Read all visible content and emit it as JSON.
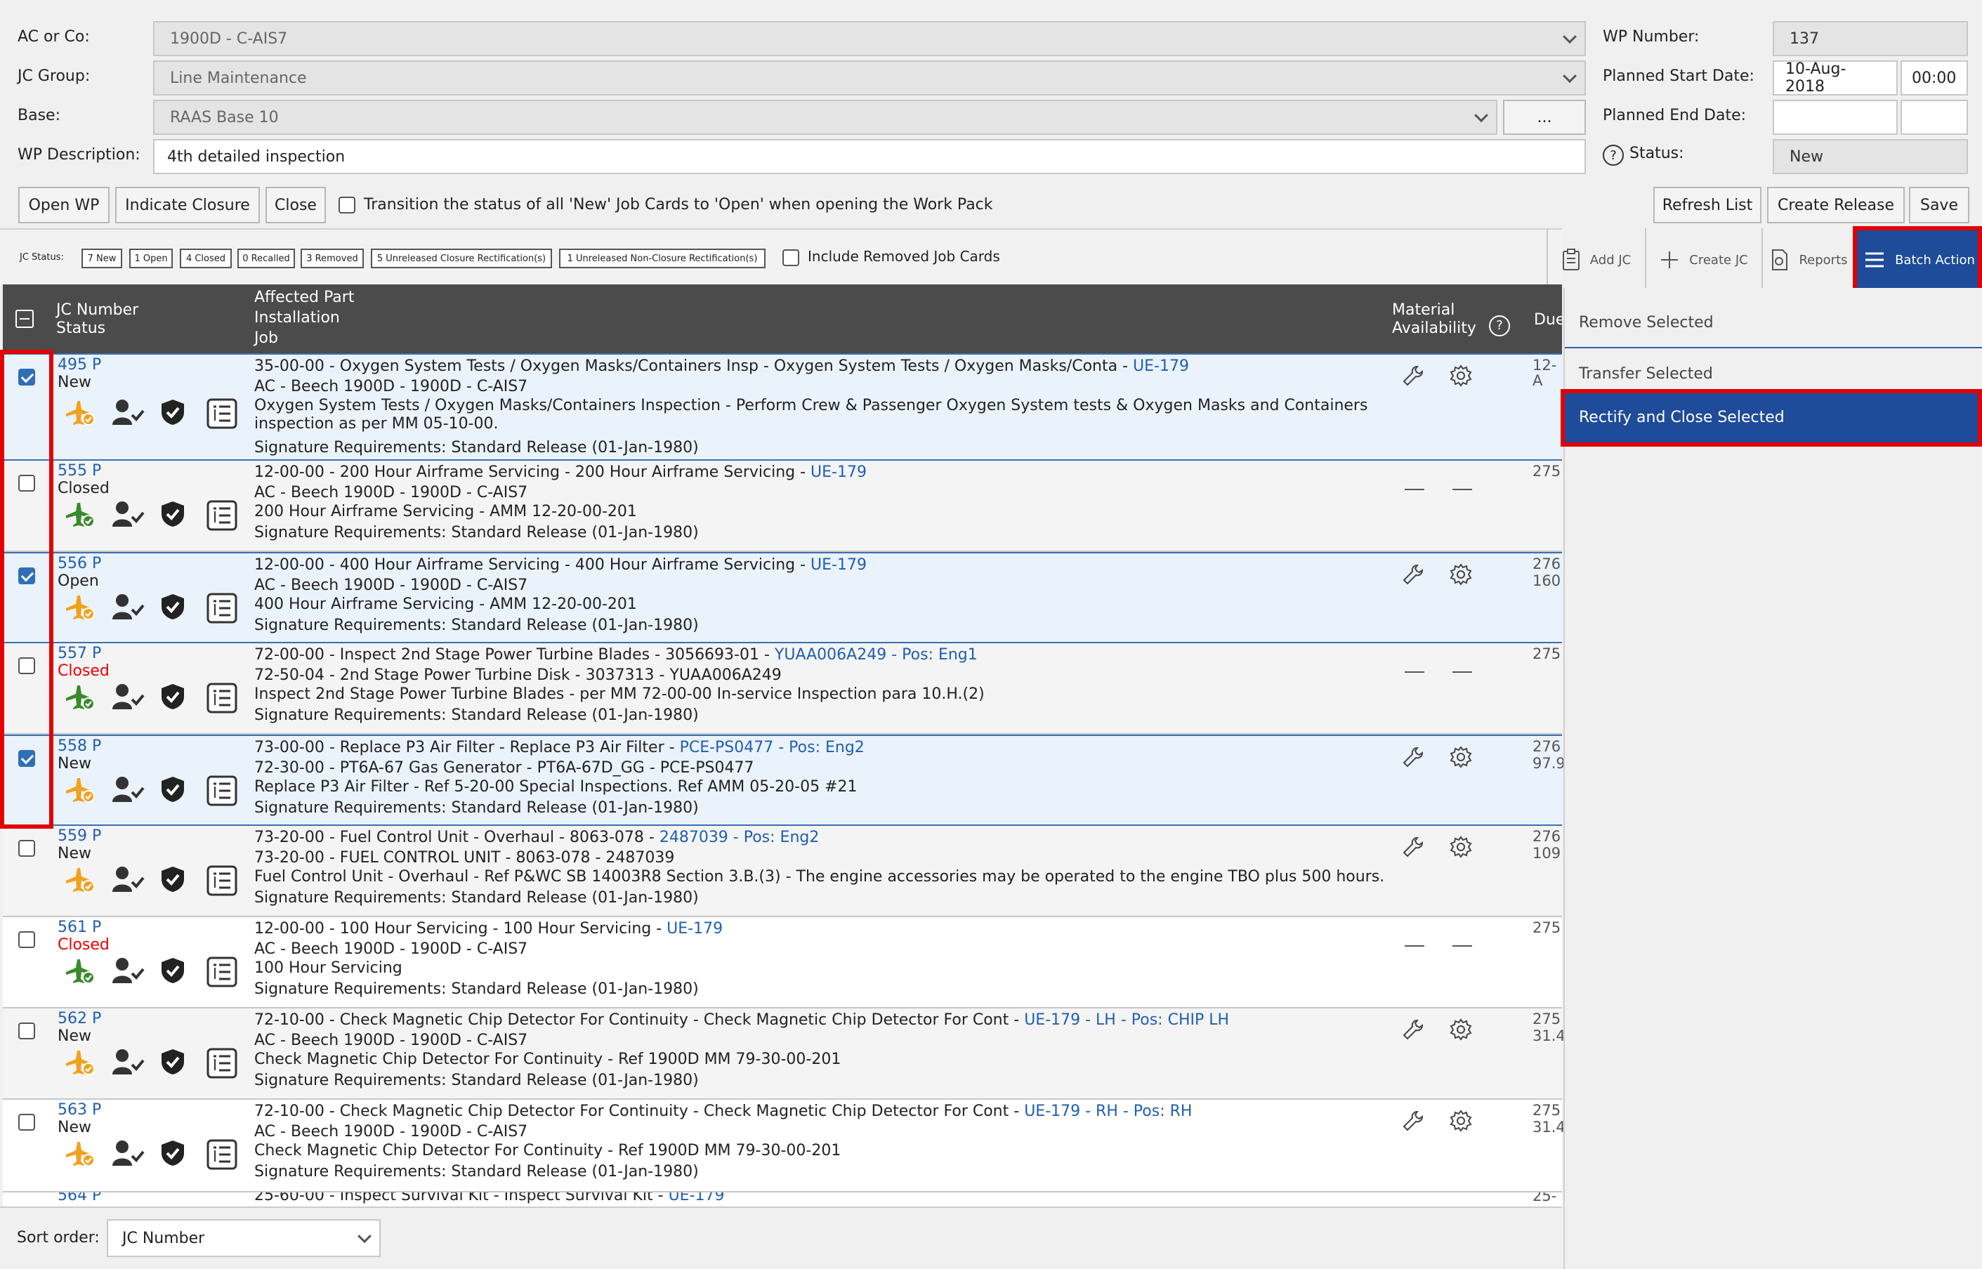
{
  "form": {
    "ac_label": "AC or Co:",
    "ac_value": "1900D - C-AIS7",
    "jc_group_label": "JC Group:",
    "jc_group_value": "Line Maintenance",
    "base_label": "Base:",
    "base_value": "RAAS Base 10",
    "base_btn": "...",
    "desc_label": "WP Description:",
    "desc_value": "4th detailed inspection",
    "wp_number_label": "WP Number:",
    "wp_number_value": "137",
    "start_label": "Planned Start Date:",
    "start_date": "10-Aug-2018",
    "start_time": "00:00",
    "end_label": "Planned End Date:",
    "end_date": "",
    "end_time": "",
    "status_label": "Status:",
    "status_value": "New"
  },
  "actions": {
    "open_wp": "Open WP",
    "indicate_closure": "Indicate Closure",
    "close": "Close",
    "transition_label": "Transition the status of all 'New' Job Cards to 'Open' when opening the Work Pack",
    "refresh": "Refresh List",
    "create_release": "Create Release",
    "save": "Save"
  },
  "status_bar": {
    "label": "JC Status:",
    "chips": [
      "7 New",
      "1 Open",
      "4 Closed",
      "0 Recalled",
      "3 Removed",
      "5 Unreleased Closure Rectification(s)",
      "1 Unreleased Non-Closure Rectification(s)"
    ],
    "include_removed": "Include Removed Job Cards"
  },
  "toolbar": {
    "add_jc": "Add JC",
    "create_jc": "Create JC",
    "reports": "Reports",
    "batch_action": "Batch Action"
  },
  "table": {
    "h_jc1": "JC Number",
    "h_jc2": "Status",
    "h_job1": "Affected Part",
    "h_job2": "Installation",
    "h_job3": "Job",
    "h_mat1": "Material",
    "h_mat2": "Availability",
    "h_due": "Due"
  },
  "rows": [
    {
      "num": "495 P",
      "status": "New",
      "l1": "35-00-00 - Oxygen System Tests / Oxygen Masks/Containers Insp - Oxygen System Tests / Oxygen Masks/Conta - ",
      "l1link": "UE-179",
      "l2": "AC - Beech 1900D - 1900D - C-AIS7",
      "l3": "Oxygen System Tests / Oxygen Masks/Containers Inspection - Perform Crew & Passenger Oxygen System tests & Oxygen Masks and Containers inspection as per MM 05-10-00.",
      "sig": "Signature Requirements: Standard Release (01-Jan-1980)",
      "due1": "12-A",
      "due2": ""
    },
    {
      "num": "555 P",
      "status": "Closed",
      "l1": "12-00-00 - 200 Hour Airframe Servicing - 200 Hour Airframe Servicing - ",
      "l1link": "UE-179",
      "l2": "AC - Beech 1900D - 1900D - C-AIS7",
      "l3": "200 Hour Airframe Servicing - AMM 12-20-00-201",
      "sig": "Signature Requirements: Standard Release (01-Jan-1980)",
      "due1": "275",
      "due2": ""
    },
    {
      "num": "556 P",
      "status": "Open",
      "l1": "12-00-00 - 400 Hour Airframe Servicing - 400 Hour Airframe Servicing - ",
      "l1link": "UE-179",
      "l2": "AC - Beech 1900D - 1900D - C-AIS7",
      "l3": "400 Hour Airframe Servicing - AMM 12-20-00-201",
      "sig": "Signature Requirements: Standard Release (01-Jan-1980)",
      "due1": "276",
      "due2": "160"
    },
    {
      "num": "557 P",
      "status": "Closed",
      "l1": "72-00-00 - Inspect 2nd Stage Power Turbine Blades - 3056693-01 - ",
      "l1link": "YUAA006A249 - Pos: Eng1",
      "l2": "72-50-04 - 2nd Stage Power Turbine Disk - 3037313 - YUAA006A249",
      "l3": "Inspect 2nd Stage Power Turbine Blades - per MM 72-00-00 In-service Inspection para 10.H.(2)",
      "sig": "Signature Requirements: Standard Release (01-Jan-1980)",
      "due1": "275",
      "due2": ""
    },
    {
      "num": "558 P",
      "status": "New",
      "l1": "73-00-00 - Replace P3 Air Filter - Replace P3 Air Filter - ",
      "l1link": "PCE-PS0477 - Pos: Eng2",
      "l2": "72-30-00 - PT6A-67 Gas Generator - PT6A-67D_GG - PCE-PS0477",
      "l3": "Replace P3 Air Filter - Ref 5-20-00 Special Inspections. Ref AMM 05-20-05 #21",
      "sig": "Signature Requirements: Standard Release (01-Jan-1980)",
      "due1": "276",
      "due2": "97.9"
    },
    {
      "num": "559 P",
      "status": "New",
      "l1": "73-20-00 - Fuel Control Unit - Overhaul - 8063-078 - ",
      "l1link": "2487039 - Pos: Eng2",
      "l2": "73-20-00 - FUEL CONTROL UNIT - 8063-078 - 2487039",
      "l3": "Fuel Control Unit - Overhaul - Ref P&WC SB 14003R8 Section 3.B.(3) - The engine accessories may be operated to the engine TBO plus 500 hours.",
      "sig": "Signature Requirements: Standard Release (01-Jan-1980)",
      "due1": "276",
      "due2": "109"
    },
    {
      "num": "561 P",
      "status": "Closed",
      "l1": "12-00-00 - 100 Hour Servicing - 100 Hour Servicing - ",
      "l1link": "UE-179",
      "l2": "AC - Beech 1900D - 1900D - C-AIS7",
      "l3": "100 Hour Servicing",
      "sig": "Signature Requirements: Standard Release (01-Jan-1980)",
      "due1": "275",
      "due2": ""
    },
    {
      "num": "562 P",
      "status": "New",
      "l1": "72-10-00 - Check Magnetic Chip Detector For Continuity - Check Magnetic Chip Detector For Cont - ",
      "l1link": "UE-179 - LH - Pos: CHIP LH",
      "l2": "AC - Beech 1900D - 1900D - C-AIS7",
      "l3": "Check Magnetic Chip Detector For Continuity - Ref 1900D MM 79-30-00-201",
      "sig": "Signature Requirements: Standard Release (01-Jan-1980)",
      "due1": "275",
      "due2": "31.4"
    },
    {
      "num": "563 P",
      "status": "New",
      "l1": "72-10-00 - Check Magnetic Chip Detector For Continuity - Check Magnetic Chip Detector For Cont - ",
      "l1link": "UE-179 - RH - Pos: RH",
      "l2": "AC - Beech 1900D - 1900D - C-AIS7",
      "l3": "Check Magnetic Chip Detector For Continuity - Ref 1900D MM 79-30-00-201",
      "sig": "Signature Requirements: Standard Release (01-Jan-1980)",
      "due1": "275",
      "due2": "31.4"
    }
  ],
  "partial_row": {
    "num": "564 P",
    "l1": "25-60-00 - Inspect Survival Kit - Inspect Survival Kit - ",
    "l1link": "UE-179",
    "due1": "25-"
  },
  "batch_menu": {
    "remove": "Remove Selected",
    "transfer": "Transfer Selected",
    "rectify": "Rectify and Close Selected"
  },
  "footer": {
    "sort_label": "Sort order:",
    "sort_value": "JC Number"
  }
}
